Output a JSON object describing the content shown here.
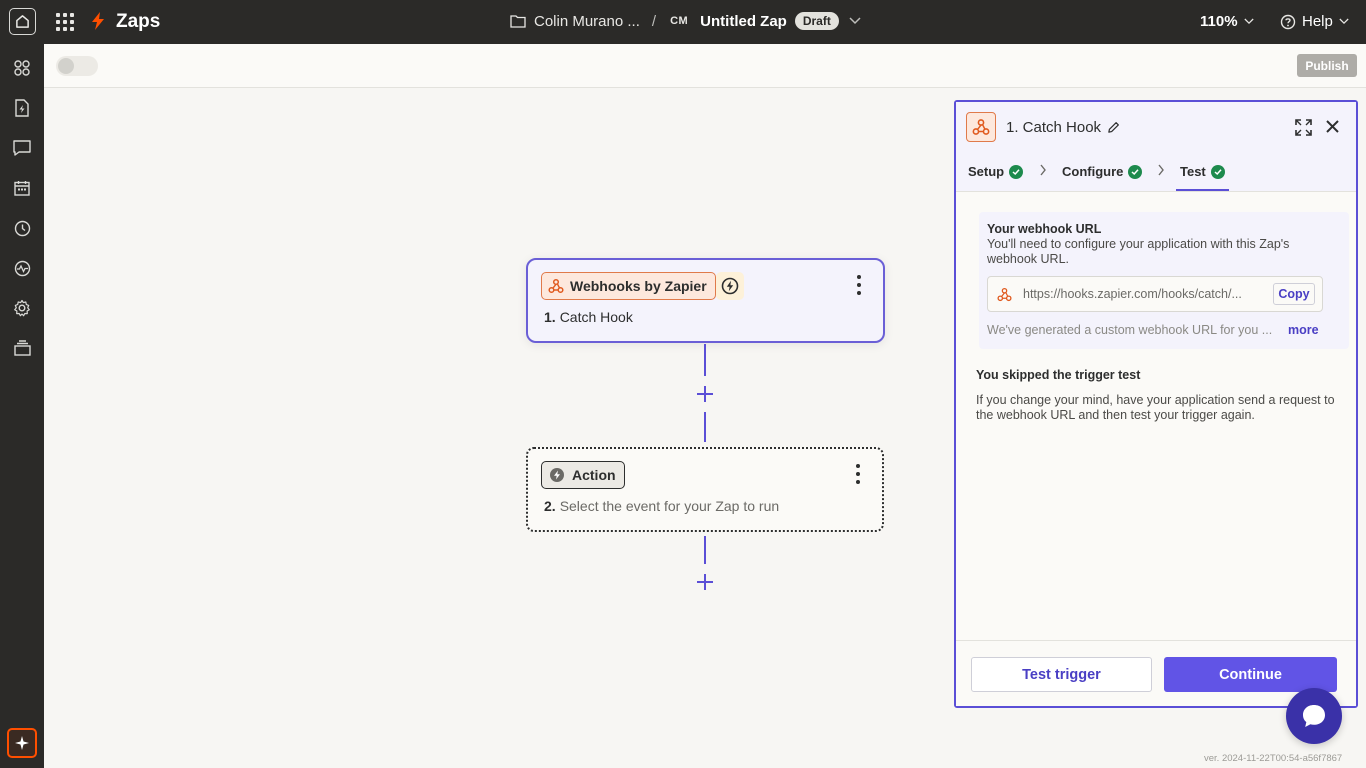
{
  "topbar": {
    "app_name": "Zaps",
    "folder": "Colin Murano ...",
    "separator": "/",
    "owner_initials": "CM",
    "zap_name": "Untitled Zap",
    "status_badge": "Draft",
    "zoom": "110%",
    "help": "Help"
  },
  "sidebar": {
    "items": [
      "apps-icon",
      "zap-file-icon",
      "chat-icon",
      "calendar-icon",
      "history-icon",
      "activity-icon",
      "settings-icon",
      "layers-icon"
    ],
    "ai_button": "sparkle-icon"
  },
  "subbar": {
    "publish_label": "Publish",
    "toggle_on": false
  },
  "canvas": {
    "trigger": {
      "app_label": "Webhooks by Zapier",
      "step_number": "1.",
      "step_title": "Catch Hook"
    },
    "action": {
      "app_label": "Action",
      "step_number": "2.",
      "step_title": "Select the event for your Zap to run"
    }
  },
  "panel": {
    "title": "1. Catch Hook",
    "tabs": [
      {
        "label": "Setup",
        "done": true
      },
      {
        "label": "Configure",
        "done": true
      },
      {
        "label": "Test",
        "done": true,
        "active": true
      }
    ],
    "webhook": {
      "title": "Your webhook URL",
      "description": "You'll need to configure your application with this Zap's webhook URL.",
      "url": "https://hooks.zapier.com/hooks/catch/...",
      "copy_label": "Copy",
      "note": "We've generated a custom webhook URL for you ...",
      "more_label": "more"
    },
    "skipped": {
      "title": "You skipped the trigger test",
      "description": "If you change your mind, have your application send a request to the webhook URL and then test your trigger again."
    },
    "footer": {
      "test_label": "Test trigger",
      "continue_label": "Continue"
    }
  },
  "version": "ver. 2024-11-22T00:54-a56f7867",
  "colors": {
    "accent": "#6154e6",
    "brand_orange": "#ff4f00",
    "success": "#1d8a4d"
  }
}
